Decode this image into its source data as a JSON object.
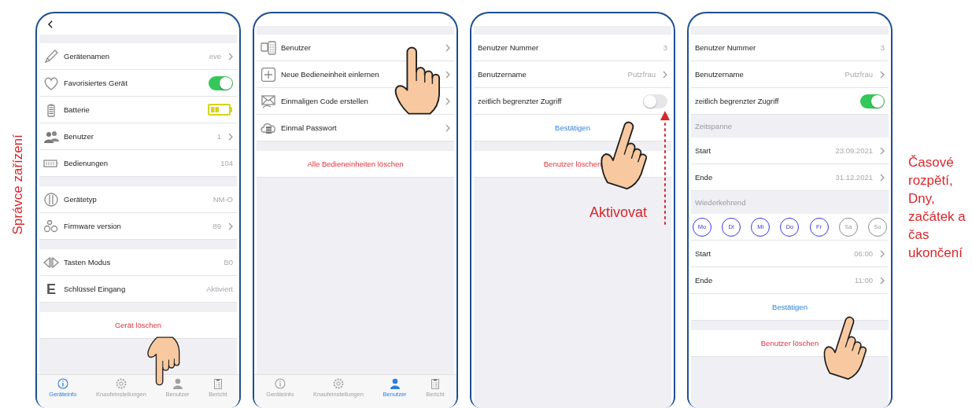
{
  "side_label": "Správce zařízení",
  "screens": [
    {
      "back_button": true,
      "sections": [
        {
          "rows": [
            {
              "kind": "value",
              "label": "Gerätenamen",
              "value": "eve",
              "chevron": true
            },
            {
              "kind": "toggle",
              "label": "Favorisiertes Gerät",
              "on": true
            },
            {
              "kind": "battery",
              "label": "Batterie"
            },
            {
              "kind": "value",
              "label": "Benutzer",
              "value": "1",
              "chevron": true
            },
            {
              "kind": "value",
              "label": "Bedienungen",
              "value": "104",
              "chevron": false
            }
          ]
        },
        {
          "rows": [
            {
              "kind": "value",
              "label": "Gerätetyp",
              "value": "NM-O",
              "chevron": false
            },
            {
              "kind": "value",
              "label": "Firmware version",
              "value": "89",
              "chevron": true
            }
          ]
        },
        {
          "rows": [
            {
              "kind": "value",
              "label": "Tasten Modus",
              "value": "B0",
              "chevron": false
            },
            {
              "kind": "value",
              "label": "Schlüssel Eingang",
              "value": "Aktiviert",
              "chevron": false,
              "glyph": "E"
            }
          ]
        },
        {
          "rows": [
            {
              "kind": "action",
              "label": "Gerät löschen",
              "danger": true
            }
          ]
        }
      ],
      "tab_bar": [
        {
          "label": "Geräteinfo",
          "selected": true
        },
        {
          "label": "Knaufeinstellungen",
          "selected": false
        },
        {
          "label": "Benutzer",
          "selected": false
        },
        {
          "label": "Bericht",
          "selected": false
        }
      ]
    },
    {
      "sections": [
        {
          "rows": [
            {
              "kind": "value",
              "label": "Benutzer",
              "chevron": true
            },
            {
              "kind": "value",
              "label": "Neue Bedieneinheit einlernen",
              "chevron": true
            },
            {
              "kind": "value",
              "label": "Einmaligen Code erstellen",
              "chevron": true
            },
            {
              "kind": "value",
              "label": "Einmal Passwort",
              "chevron": true
            }
          ]
        },
        {
          "rows": [
            {
              "kind": "action",
              "label": "Alle Bedieneinheiten löschen",
              "danger": true
            }
          ]
        }
      ],
      "tab_bar": [
        {
          "label": "Geräteinfo",
          "selected": false
        },
        {
          "label": "Knaufeinstellungen",
          "selected": false
        },
        {
          "label": "Benutzer",
          "selected": true
        },
        {
          "label": "Bericht",
          "selected": false
        }
      ]
    },
    {
      "annotation": "Aktivovat",
      "sections": [
        {
          "rows": [
            {
              "kind": "value",
              "label": "Benutzer Nummer",
              "value": "3",
              "chevron": false
            },
            {
              "kind": "value",
              "label": "Benutzername",
              "value": "Putzfrau",
              "chevron": true
            },
            {
              "kind": "toggle",
              "label": "zeitlich begrenzter Zugriff",
              "on": false
            },
            {
              "kind": "action",
              "label": "Bestätigen",
              "danger": false
            }
          ]
        },
        {
          "rows": [
            {
              "kind": "action",
              "label": "Benutzer löschen",
              "danger": true
            }
          ]
        }
      ]
    },
    {
      "sections": [
        {
          "rows": [
            {
              "kind": "value",
              "label": "Benutzer Nummer",
              "value": "3",
              "chevron": false
            },
            {
              "kind": "value",
              "label": "Benutzername",
              "value": "Putzfrau",
              "chevron": true
            },
            {
              "kind": "toggle",
              "label": "zeitlich begrenzter Zugriff",
              "on": true
            }
          ]
        },
        {
          "header": "Zeitspanne",
          "rows": [
            {
              "kind": "value",
              "label": "Start",
              "value": "23.09.2021",
              "chevron": true
            },
            {
              "kind": "value",
              "label": "Ende",
              "value": "31.12.2021",
              "chevron": true
            }
          ]
        },
        {
          "header": "Wiederkehrend",
          "rows": [
            {
              "kind": "days",
              "days": [
                {
                  "label": "Mo",
                  "selected": true
                },
                {
                  "label": "Di",
                  "selected": true
                },
                {
                  "label": "Mi",
                  "selected": true
                },
                {
                  "label": "Do",
                  "selected": true
                },
                {
                  "label": "Fr",
                  "selected": true
                },
                {
                  "label": "Sa",
                  "selected": false
                },
                {
                  "label": "So",
                  "selected": false
                }
              ]
            },
            {
              "kind": "value",
              "label": "Start",
              "value": "06:00",
              "chevron": true
            },
            {
              "kind": "value",
              "label": "Ende",
              "value": "11:00",
              "chevron": true
            },
            {
              "kind": "action",
              "label": "Bestätigen",
              "danger": false
            }
          ]
        },
        {
          "rows": [
            {
              "kind": "action",
              "label": "Benutzer löschen",
              "danger": true
            }
          ]
        }
      ]
    }
  ],
  "side_note": "Časové rozpětí, Dny, začátek a čas ukončení"
}
